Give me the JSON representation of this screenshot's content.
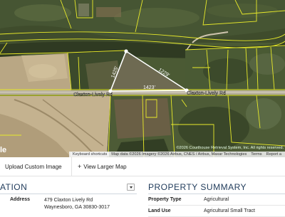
{
  "map": {
    "logo": "le",
    "road_label_left": "Claxton-Lively Rd",
    "road_label_right": "Claxton-Lively Rd",
    "dim_top": "1229'",
    "dim_left": "1425'",
    "dim_bottom": "1423'",
    "court_attr": "©2026 Courthouse Retrieval System, Inc. All rights reserved.",
    "attribution": {
      "shortcuts": "Keyboard shortcuts",
      "data": "Map data ©2026 Imagery ©2026 Airbus, CNES / Airbus, Maxar Technologies",
      "terms": "Terms",
      "report": "Report a"
    },
    "colors": {
      "parcel": "#e8ea2a",
      "subject": "#ffffff"
    }
  },
  "toolbar": {
    "upload": "Upload Custom Image",
    "view_larger": "View Larger Map"
  },
  "location": {
    "title": "ATION",
    "address_label": "Address",
    "address_line1": "479 Claxton Lively Rd",
    "address_line2": "Waynesboro, GA 30830-3017"
  },
  "summary": {
    "title": "PROPERTY SUMMARY",
    "type_label": "Property Type",
    "type_value": "Agricultural",
    "use_label": "Land Use",
    "use_value": "Agricultural Small Tract"
  }
}
